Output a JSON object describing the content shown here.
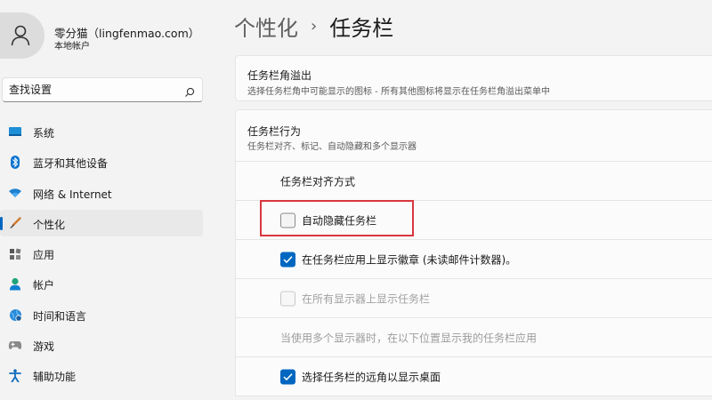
{
  "user": {
    "name": "零分猫（lingfenmao.com）",
    "account_type": "本地帐户"
  },
  "search": {
    "placeholder": "查找设置"
  },
  "nav": {
    "items": [
      {
        "label": "系统",
        "icon": "monitor-icon"
      },
      {
        "label": "蓝牙和其他设备",
        "icon": "bluetooth-icon"
      },
      {
        "label": "网络 & Internet",
        "icon": "wifi-icon"
      },
      {
        "label": "个性化",
        "icon": "brush-icon",
        "active": true
      },
      {
        "label": "应用",
        "icon": "apps-icon"
      },
      {
        "label": "帐户",
        "icon": "person-icon"
      },
      {
        "label": "时间和语言",
        "icon": "globe-clock-icon"
      },
      {
        "label": "游戏",
        "icon": "gamepad-icon"
      },
      {
        "label": "辅助功能",
        "icon": "accessibility-icon"
      }
    ]
  },
  "breadcrumb": {
    "parent": "个性化",
    "separator": "›",
    "current": "任务栏"
  },
  "overflow_card": {
    "title": "任务栏角溢出",
    "description": "选择任务栏角中可能显示的图标 - 所有其他图标将显示在任务栏角溢出菜单中"
  },
  "behaviors": {
    "title": "任务栏行为",
    "description": "任务栏对齐、标记、自动隐藏和多个显示器",
    "alignment_label": "任务栏对齐方式",
    "auto_hide": {
      "label": "自动隐藏任务栏",
      "checked": false
    },
    "show_badges": {
      "label": "在任务栏应用上显示徽章 (未读邮件计数器)。",
      "checked": true
    },
    "show_all_displays": {
      "label": "在所有显示器上显示任务栏",
      "checked": false,
      "disabled": true
    },
    "multi_display_note": "当使用多个显示器时，在以下位置显示我的任务栏应用",
    "show_desktop": {
      "label": "选择任务栏的远角以显示桌面",
      "checked": true
    }
  },
  "colors": {
    "accent": "#0067c0",
    "highlight": "#d9363e"
  }
}
